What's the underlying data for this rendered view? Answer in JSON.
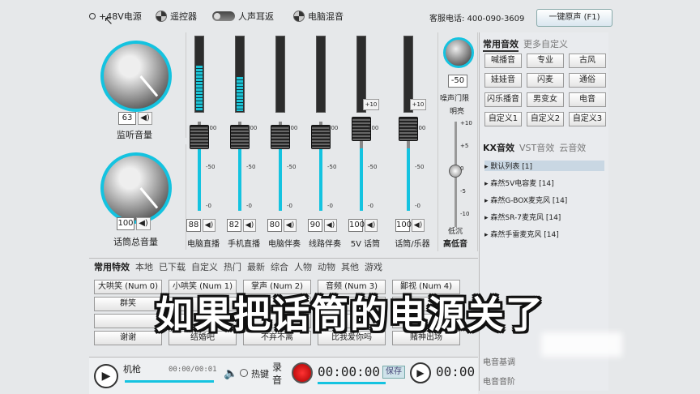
{
  "topbar": {
    "phantom_power": "+48V电源",
    "remote": "遥控器",
    "vocal_return": "人声耳返",
    "pc_mix": "电脑混音",
    "hotline": "客服电话: 400-090-3609",
    "one_click": "一键原声 (F1)"
  },
  "monitor": {
    "value": "63",
    "label": "监听音量"
  },
  "master": {
    "value": "100",
    "label": "话筒总音量"
  },
  "channels": [
    {
      "label": "电脑直播",
      "value": "88",
      "level": 0.6
    },
    {
      "label": "手机直播",
      "value": "82",
      "level": 0.45
    },
    {
      "label": "电脑伴奏",
      "value": "80",
      "level": 0.0
    },
    {
      "label": "线路伴奏",
      "value": "90",
      "level": 0.0
    },
    {
      "label": "5V 话筒",
      "value": "100",
      "level": 0.0,
      "boost": "+10"
    },
    {
      "label": "话筒/乐器",
      "value": "100",
      "level": 0.0,
      "boost": "+10"
    }
  ],
  "scale_ticks": [
    "100",
    "-50",
    "-0"
  ],
  "gate": {
    "value": "-50",
    "label": "噪声门限"
  },
  "eq": {
    "top": "明亮",
    "bottom": "低沉",
    "label": "高低音",
    "ticks": [
      "+10",
      "+5",
      "0",
      "-5",
      "-10"
    ]
  },
  "right": {
    "tab_common": "常用音效",
    "tab_more": "更多自定义",
    "effects": [
      "喊播音",
      "专业",
      "古风",
      "娃娃音",
      "闪麦",
      "通俗",
      "闪乐播音",
      "男变女",
      "电音",
      "自定义1",
      "自定义2",
      "自定义3"
    ],
    "kx_tabs": [
      "KX音效",
      "VST音效",
      "云音效"
    ],
    "presets": [
      "默认列表 [1]",
      "森然5V电容麦 [14]",
      "森然G-BOX麦克风 [14]",
      "森然SR-7麦克风 [14]",
      "森然手雷麦克风 [14]"
    ],
    "field1": "电音基调",
    "field2": "电音音阶"
  },
  "fx": {
    "tabs": [
      "常用特效",
      "本地",
      "已下载",
      "自定义",
      "热门",
      "最新",
      "综合",
      "人物",
      "动物",
      "其他",
      "游戏"
    ],
    "row1": [
      "大哄笑 (Num 0)",
      "小哄笑 (Num 1)",
      "掌声 (Num 2)",
      "音频 (Num 3)",
      "鄙视 (Num 4)"
    ],
    "row2": [
      "群笑",
      "",
      "",
      "",
      ""
    ],
    "row3": [
      "",
      "",
      "",
      "",
      ""
    ],
    "row4": [
      "谢谢",
      "结婚吧",
      "不弃不离",
      "比我爱你吗",
      "赌神出场"
    ]
  },
  "player": {
    "track": "机枪",
    "time": "00:00/00:01",
    "hotkey": "热键",
    "record": "录音",
    "rec_time": "00:00:00",
    "save": "保存",
    "rec_time2": "00:00"
  },
  "subtitle": "如果把话筒的电源关了"
}
